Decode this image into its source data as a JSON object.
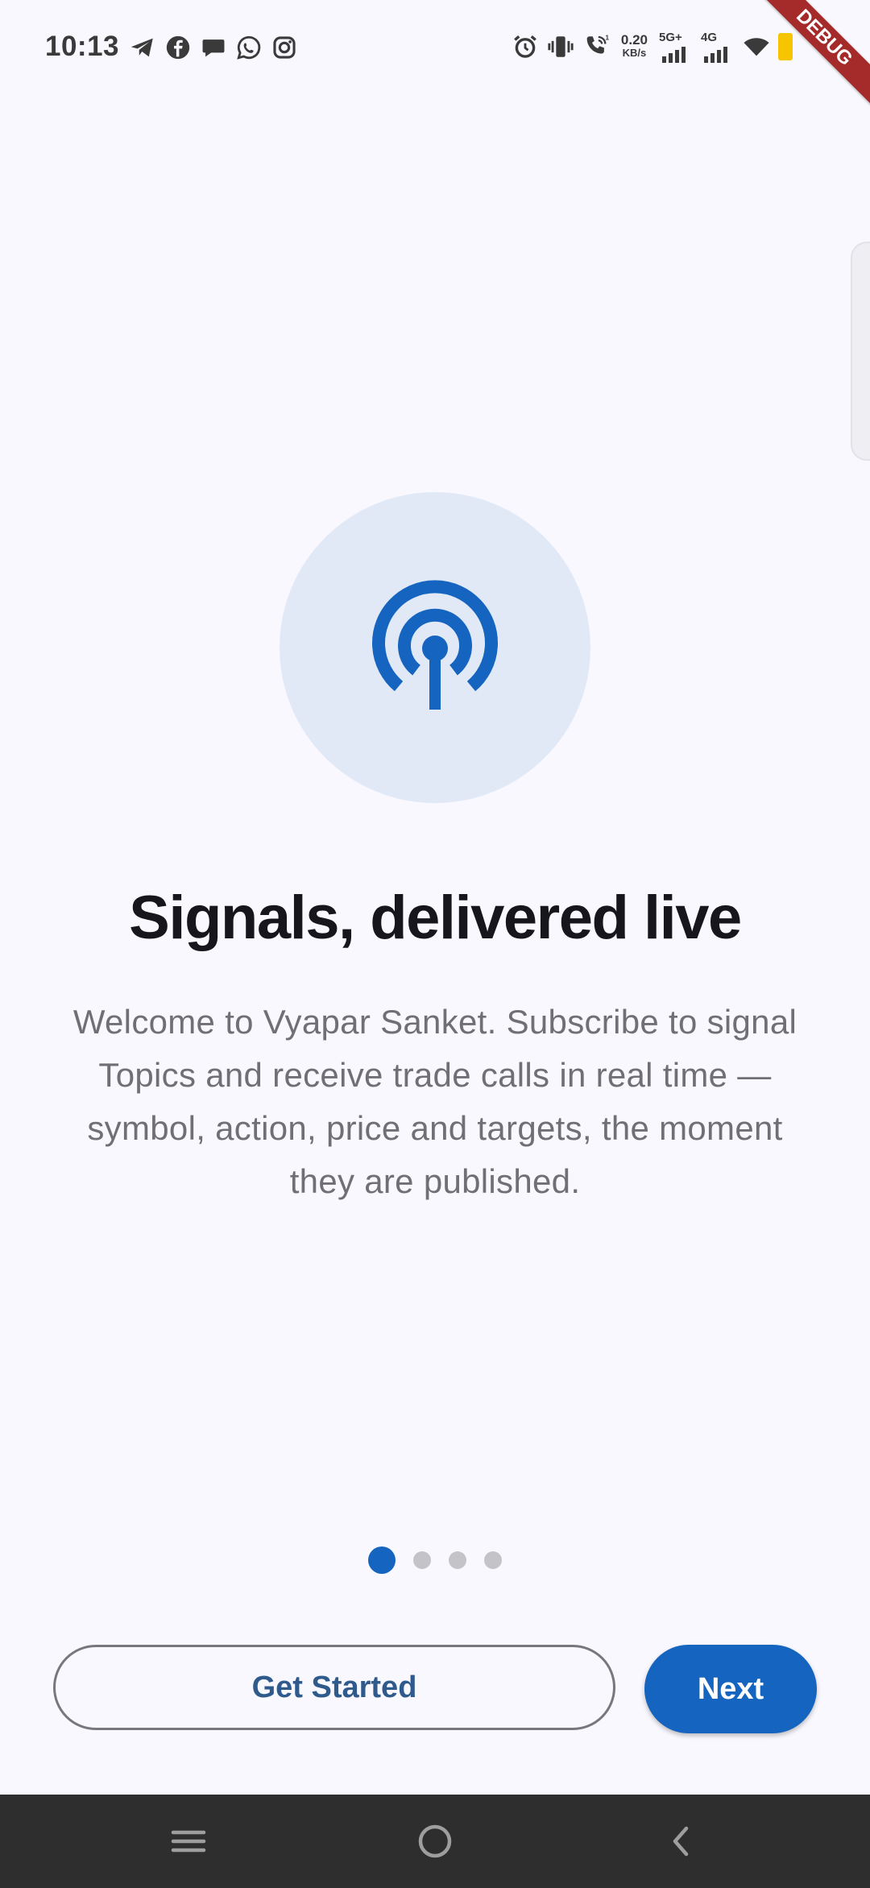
{
  "status_bar": {
    "time": "10:13",
    "net_speed_value": "0.20",
    "net_speed_unit": "KB/s",
    "sim1_label": "5G+",
    "sim2_label": "4G",
    "icons_left": [
      "telegram-icon",
      "facebook-icon",
      "chat-bubble-icon",
      "whatsapp-icon",
      "instagram-icon"
    ],
    "icons_right": [
      "alarm-icon",
      "vibrate-icon",
      "wifi-calling-icon",
      "signal-5g-icon",
      "signal-4g-icon",
      "wifi-icon",
      "battery-icon"
    ],
    "battery_color": "#f7c400"
  },
  "debug_banner": "DEBUG",
  "onboarding": {
    "title": "Signals, delivered live",
    "description": "Welcome to Vyapar Sanket. Subscribe to signal Topics and receive trade calls in real time — symbol, action, price and targets, the moment they are published.",
    "hero_icon": "broadcast-signal-icon",
    "page_count": 4,
    "current_page": 1
  },
  "actions": {
    "get_started_label": "Get Started",
    "next_label": "Next"
  },
  "nav_bar": {
    "buttons": [
      "menu-icon",
      "home-icon",
      "back-icon"
    ]
  },
  "colors": {
    "accent": "#1565c0",
    "background": "#f8f8fe",
    "hero_circle": "#e1e9f7",
    "inactive_dot": "#c4c4c8",
    "debug_banner": "#a52a2a"
  }
}
